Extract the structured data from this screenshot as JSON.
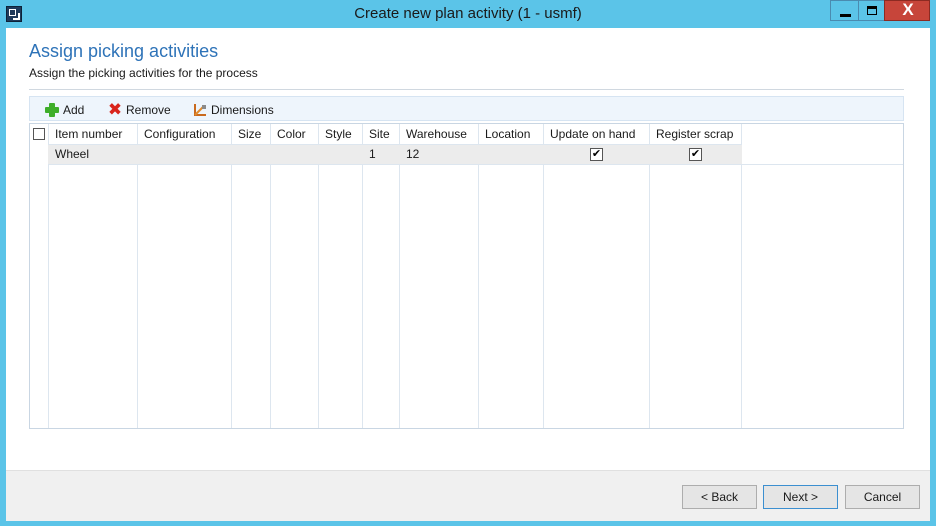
{
  "window": {
    "title": "Create new plan activity (1 - usmf)",
    "close_glyph": "X"
  },
  "page": {
    "heading": "Assign picking activities",
    "subheading": "Assign the picking activities for the process"
  },
  "toolbar": {
    "add_label": "Add",
    "remove_label": "Remove",
    "dimensions_label": "Dimensions"
  },
  "grid": {
    "columns": [
      "Item number",
      "Configuration",
      "Size",
      "Color",
      "Style",
      "Site",
      "Warehouse",
      "Location",
      "Update on hand",
      "Register scrap"
    ],
    "rows": [
      {
        "item_number": "Wheel",
        "configuration": "",
        "size": "",
        "color": "",
        "style": "",
        "site": "1",
        "warehouse": "12",
        "location": "",
        "update_on_hand": true,
        "register_scrap": true
      }
    ]
  },
  "footer": {
    "back_label": "< Back",
    "next_label": "Next >",
    "cancel_label": "Cancel"
  },
  "colors": {
    "title_bar": "#5bc4e8",
    "heading": "#2e73b8",
    "close_button": "#c7453a"
  }
}
